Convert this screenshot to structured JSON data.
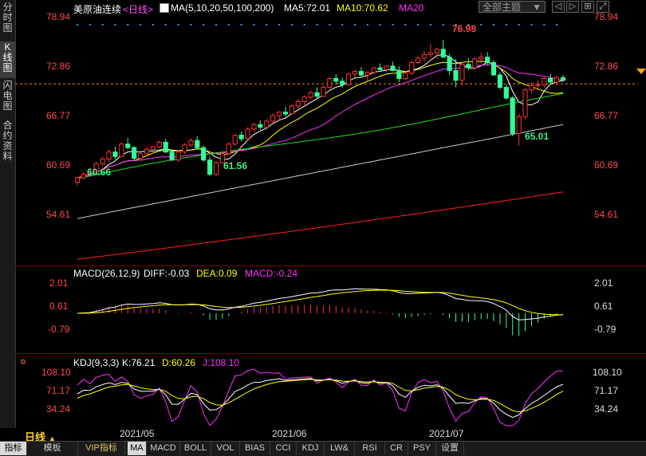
{
  "left_tabs": [
    {
      "label": "分时图",
      "active": false
    },
    {
      "label": "K线图",
      "active": true
    },
    {
      "label": "闪电图",
      "active": false
    },
    {
      "label": "合约资料",
      "active": false
    }
  ],
  "header": {
    "symbol": "美原油连续",
    "period": "<日线>",
    "ma_label": "MA(5,10,20,50,100,200)",
    "ma5": "MA5:72.01",
    "ma10": "MA10:70.62",
    "ma20": "MA20",
    "dropdown": "全部主题",
    "icons": [
      "prev-icon",
      "next-icon",
      "grid-icon",
      "expand-icon"
    ]
  },
  "price_axis": {
    "labels": [
      "78.94",
      "72.86",
      "66.77",
      "60.69",
      "54.61"
    ],
    "current": "72.86"
  },
  "annotations": {
    "high": "76.98",
    "low1": "60.66",
    "low2": "61.56",
    "low3": "65.01"
  },
  "macd": {
    "title": "MACD(26,12,9)",
    "diff": "DIFF:-0.03",
    "dea": "DEA:0.09",
    "macd": "MACD:-0.24",
    "labels": [
      "2.01",
      "0.61",
      "-0.79"
    ]
  },
  "kdj": {
    "title": "KDJ(9,3,3)",
    "k": "K:76.21",
    "d": "D:60.26",
    "j": "J:108.10",
    "labels": [
      "108.10",
      "71.17",
      "34.24"
    ]
  },
  "x_labels": [
    "2021/05",
    "2021/06",
    "2021/07"
  ],
  "period_selector": "日线",
  "bottom_tabs": [
    "指标",
    "模板",
    "VIP指标",
    "MA",
    "MACD",
    "BOLL",
    "VOL",
    "BIAS",
    "CCI",
    "KDJ",
    "LW&",
    "RSI",
    "CR",
    "PSY",
    "设置"
  ],
  "bottom_active": "MA",
  "colors": {
    "up": "#ff3333",
    "down": "#33ff99",
    "ma5": "#ffffff",
    "ma10": "#ffff00",
    "ma20": "#ff33ff",
    "ma50": "#22dd22",
    "ma100": "#cccccc",
    "ma200": "#ff2222",
    "bg": "#000000"
  },
  "chart_data": {
    "type": "candlestick",
    "ohlc": [
      [
        60.9,
        61.5,
        60.6,
        61.4
      ],
      [
        61.4,
        62.0,
        61.2,
        61.8
      ],
      [
        61.8,
        62.5,
        61.5,
        61.9
      ],
      [
        61.9,
        63.2,
        61.8,
        63.0
      ],
      [
        63.0,
        63.8,
        62.7,
        63.5
      ],
      [
        63.5,
        64.6,
        63.2,
        64.3
      ],
      [
        64.3,
        64.9,
        63.5,
        63.8
      ],
      [
        63.8,
        65.4,
        63.7,
        65.2
      ],
      [
        65.2,
        65.9,
        64.6,
        64.8
      ],
      [
        64.8,
        65.0,
        63.3,
        63.6
      ],
      [
        63.6,
        64.2,
        63.3,
        64.1
      ],
      [
        64.1,
        64.9,
        63.9,
        64.6
      ],
      [
        64.6,
        65.0,
        64.1,
        64.9
      ],
      [
        64.9,
        65.6,
        64.7,
        65.4
      ],
      [
        65.4,
        65.8,
        64.2,
        64.3
      ],
      [
        64.3,
        64.6,
        63.3,
        63.4
      ],
      [
        63.4,
        64.5,
        63.2,
        64.3
      ],
      [
        64.3,
        65.3,
        64.1,
        65.1
      ],
      [
        65.1,
        65.9,
        64.9,
        65.6
      ],
      [
        65.6,
        66.1,
        64.6,
        64.8
      ],
      [
        64.8,
        65.0,
        63.2,
        63.4
      ],
      [
        63.4,
        63.8,
        61.6,
        61.8
      ],
      [
        61.8,
        63.3,
        61.6,
        63.1
      ],
      [
        63.1,
        64.3,
        63.0,
        64.1
      ],
      [
        64.1,
        65.4,
        64.0,
        65.2
      ],
      [
        65.2,
        66.3,
        65.0,
        66.2
      ],
      [
        66.2,
        66.6,
        65.5,
        65.8
      ],
      [
        65.8,
        67.1,
        65.6,
        66.9
      ],
      [
        66.9,
        67.6,
        66.6,
        67.4
      ],
      [
        67.4,
        67.9,
        66.8,
        67.1
      ],
      [
        67.1,
        68.0,
        66.9,
        67.8
      ],
      [
        67.8,
        68.7,
        67.6,
        68.4
      ],
      [
        68.4,
        68.9,
        67.9,
        68.8
      ],
      [
        68.8,
        69.4,
        68.3,
        68.6
      ],
      [
        68.6,
        69.7,
        68.5,
        69.5
      ],
      [
        69.5,
        70.3,
        69.2,
        70.0
      ],
      [
        70.0,
        70.7,
        69.6,
        70.5
      ],
      [
        70.5,
        71.2,
        70.2,
        71.0
      ],
      [
        71.0,
        71.6,
        70.4,
        70.6
      ],
      [
        70.6,
        71.8,
        70.5,
        71.6
      ],
      [
        71.6,
        72.8,
        71.4,
        72.6
      ],
      [
        72.6,
        73.1,
        71.9,
        72.3
      ],
      [
        72.3,
        72.7,
        71.6,
        71.9
      ],
      [
        71.9,
        73.3,
        71.8,
        73.1
      ],
      [
        73.1,
        73.6,
        72.7,
        73.4
      ],
      [
        73.4,
        73.9,
        72.7,
        73.0
      ],
      [
        73.0,
        73.4,
        72.3,
        73.3
      ],
      [
        73.3,
        73.9,
        73.1,
        73.8
      ],
      [
        73.8,
        74.3,
        73.5,
        73.6
      ],
      [
        73.6,
        74.1,
        73.3,
        74.0
      ],
      [
        74.0,
        74.5,
        73.4,
        73.5
      ],
      [
        73.5,
        74.0,
        72.2,
        72.6
      ],
      [
        72.6,
        73.4,
        72.4,
        73.2
      ],
      [
        73.2,
        74.6,
        73.0,
        74.4
      ],
      [
        74.4,
        75.1,
        74.2,
        74.9
      ],
      [
        74.9,
        75.7,
        74.5,
        75.3
      ],
      [
        75.3,
        76.5,
        75.0,
        75.5
      ],
      [
        75.5,
        76.1,
        74.8,
        75.9
      ],
      [
        75.9,
        76.98,
        75.2,
        75.0
      ],
      [
        75.0,
        75.4,
        73.0,
        73.5
      ],
      [
        73.5,
        74.8,
        71.6,
        72.4
      ],
      [
        72.4,
        74.4,
        71.8,
        74.2
      ],
      [
        74.2,
        74.9,
        73.5,
        73.8
      ],
      [
        73.8,
        75.0,
        73.6,
        74.8
      ],
      [
        74.8,
        75.5,
        74.3,
        75.0
      ],
      [
        75.0,
        75.6,
        74.1,
        74.4
      ],
      [
        74.4,
        74.7,
        72.9,
        73.0
      ],
      [
        73.0,
        73.3,
        71.4,
        71.6
      ],
      [
        71.6,
        71.9,
        70.2,
        70.4
      ],
      [
        70.4,
        70.6,
        66.1,
        66.4
      ],
      [
        66.4,
        68.6,
        65.01,
        68.3
      ],
      [
        68.3,
        71.5,
        68.0,
        71.3
      ],
      [
        71.3,
        72.2,
        70.9,
        71.8
      ],
      [
        71.8,
        72.4,
        71.3,
        71.9
      ],
      [
        71.9,
        72.8,
        71.6,
        72.6
      ],
      [
        72.6,
        73.1,
        72.0,
        72.2
      ],
      [
        72.2,
        72.9,
        71.9,
        72.7
      ],
      [
        72.7,
        73.0,
        72.2,
        72.4
      ]
    ],
    "x_labels": [
      "2021/05",
      "2021/06",
      "2021/07"
    ],
    "y_range": [
      51.5,
      80.2
    ],
    "annotations": [
      {
        "label": "76.98",
        "type": "high"
      },
      {
        "label": "60.66",
        "type": "low"
      },
      {
        "label": "61.56",
        "type": "low"
      },
      {
        "label": "65.01",
        "type": "low"
      }
    ]
  }
}
